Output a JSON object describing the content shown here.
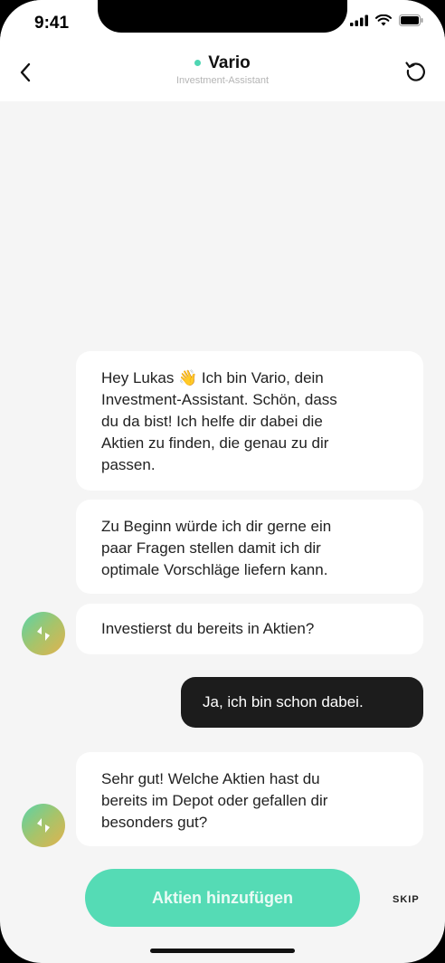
{
  "status_bar": {
    "time": "9:41"
  },
  "header": {
    "title": "Vario",
    "subtitle": "Investment-Assistant",
    "accent_color": "#4fd6b3",
    "back_icon": "chevron-left-icon",
    "reset_icon": "restart-icon"
  },
  "messages": [
    {
      "from": "bot",
      "text": "Hey Lukas 👋 Ich bin Vario, dein\nInvestment-Assistant. Schön, dass\ndu da bist! Ich helfe dir dabei die\nAktien zu finden, die genau zu dir\npassen."
    },
    {
      "from": "bot",
      "text": "Zu Beginn würde ich dir gerne ein\npaar Fragen stellen damit ich dir\noptimale Vorschläge liefern kann."
    },
    {
      "from": "bot",
      "text": "Investierst du bereits in Aktien?"
    },
    {
      "from": "user",
      "text": "Ja, ich bin schon dabei."
    },
    {
      "from": "bot",
      "text": "Sehr gut! Welche Aktien hast du\nbereits im Depot oder gefallen dir\nbesonders gut?"
    }
  ],
  "footer": {
    "cta_label": "Aktien hinzufügen",
    "skip_label": "SKIP",
    "cta_color": "#55dbb5"
  }
}
